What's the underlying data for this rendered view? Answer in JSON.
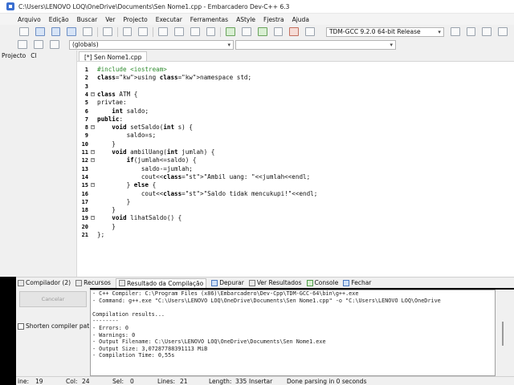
{
  "title": "C:\\Users\\LENOVO LOQ\\OneDrive\\Documents\\Sen Nome1.cpp - Embarcadero Dev-C++ 6.3",
  "menu": [
    "Arquivo",
    "Edição",
    "Buscar",
    "Ver",
    "Projecto",
    "Executar",
    "Ferramentas",
    "AStyle",
    "Fjestra",
    "Ajuda"
  ],
  "toolbar": {
    "compiler": "TDM-GCC 9.2.0 64-bit Release",
    "scope": "(globals)"
  },
  "left_panel": {
    "tab_project": "Projecto",
    "tab_classes": "Cl"
  },
  "file_tab": "[*] Sen Nome1.cpp",
  "code": [
    {
      "n": "1",
      "t": "#include <iostream>"
    },
    {
      "n": "2",
      "t": "using namespace std;"
    },
    {
      "n": "3",
      "t": ""
    },
    {
      "n": "4",
      "t": "class ATM {"
    },
    {
      "n": "5",
      "t": "privtae:"
    },
    {
      "n": "6",
      "t": "    int saldo;"
    },
    {
      "n": "7",
      "t": "public:"
    },
    {
      "n": "8",
      "t": "    void setSaldo(int s) {"
    },
    {
      "n": "9",
      "t": "        saldo=s;"
    },
    {
      "n": "10",
      "t": "    }"
    },
    {
      "n": "11",
      "t": "    void ambilUang(int jumlah) {"
    },
    {
      "n": "12",
      "t": "        if(jumlah<=saldo) {"
    },
    {
      "n": "13",
      "t": "            saldo-=jumlah;"
    },
    {
      "n": "14",
      "t": "            cout<<\"Ambil uang: \"<<jumlah<<endl;"
    },
    {
      "n": "15",
      "t": "        } else {"
    },
    {
      "n": "16",
      "t": "            cout<<\"Saldo tidak mencukupi!\"<<endl;"
    },
    {
      "n": "17",
      "t": "        }"
    },
    {
      "n": "18",
      "t": "    }"
    },
    {
      "n": "19",
      "t": "    void lihatSaldo() {"
    },
    {
      "n": "20",
      "t": "    }"
    },
    {
      "n": "21",
      "t": "};"
    }
  ],
  "bottom_tabs": [
    "Compilador (2)",
    "Recursos",
    "Resultado da Compilação",
    "Depurar",
    "Ver Resultados",
    "Console",
    "Fechar"
  ],
  "cancel_label": "Cancelar",
  "shorten_label": "Shorten compiler pat",
  "log": [
    "- C++ Compiler: C:\\Program Files (x86)\\Embarcadero\\Dev-Cpp\\TDM-GCC-64\\bin\\g++.exe",
    "- Command: g++.exe \"C:\\Users\\LENOVO LOQ\\OneDrive\\Documents\\Sen Nome1.cpp\" -o \"C:\\Users\\LENOVO LOQ\\OneDrive",
    "",
    "Compilation results...",
    "--------",
    "- Errors: 0",
    "- Warnings: 0",
    "- Output Filename: C:\\Users\\LENOVO LOQ\\OneDrive\\Documents\\Sen Nome1.exe",
    "- Output Size: 3,07287788391113 MiB",
    "- Compilation Time: 0,55s"
  ],
  "status": {
    "line_label": "ine:",
    "line_value": "19",
    "col_label": "Col:",
    "col_value": "24",
    "sel_label": "Sel:",
    "sel_value": "0",
    "lines_label": "Lines:",
    "lines_value": "21",
    "length_label": "Length:",
    "length_value": "335",
    "mode": "Insertar",
    "message": "Done parsing in 0 seconds"
  }
}
